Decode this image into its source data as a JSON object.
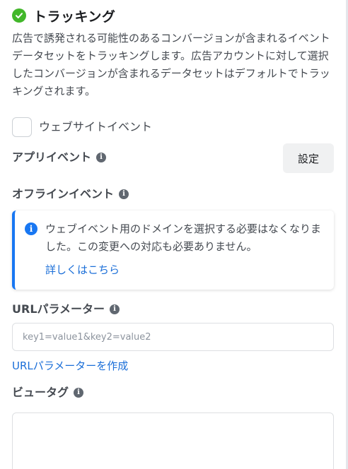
{
  "header": {
    "title": "トラッキング",
    "description": "広告で誘発される可能性のあるコンバージョンが含まれるイベントデータセットをトラッキングします。広告アカウントに対して選択したコンバージョンが含まれるデータセットはデフォルトでトラッキングされます。"
  },
  "website_events": {
    "label": "ウェブサイトイベント",
    "checked": false
  },
  "app_events": {
    "label": "アプリイベント",
    "button_label": "設定"
  },
  "offline_events": {
    "label": "オフラインイベント"
  },
  "notice": {
    "text": "ウェブイベント用のドメインを選択する必要はなくなりました。この変更への対応も必要ありません。",
    "link": "詳しくはこちら"
  },
  "url_parameters": {
    "label": "URLパラメーター",
    "placeholder": "key1=value1&key2=value2",
    "value": "",
    "create_link": "URLパラメーターを作成"
  },
  "view_tags": {
    "label": "ビュータグ",
    "value": ""
  },
  "colors": {
    "accent": "#1877f2",
    "success": "#42b72a",
    "link": "#1a6ed8"
  }
}
